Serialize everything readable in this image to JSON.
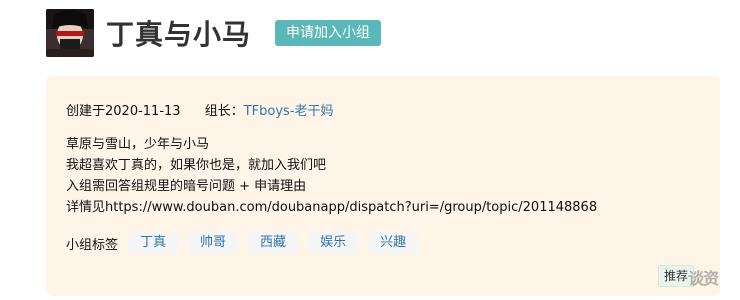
{
  "group": {
    "name": "丁真与小马",
    "join_button": "申请加入小组",
    "created_label": "创建于",
    "created_date": "2020-11-13",
    "owner_label": "组长：",
    "owner_name": "TFboys-老干妈",
    "description": [
      "草原与雪山，少年与小马",
      "我超喜欢丁真的，如果你也是，就加入我们吧",
      "入组需回答组规里的暗号问题 + 申请理由",
      "详情见https://www.douban.com/doubanapp/dispatch?uri=/group/topic/201148868"
    ],
    "tags_label": "小组标签",
    "tags": [
      "丁真",
      "帅哥",
      "西藏",
      "娱乐",
      "兴趣"
    ]
  },
  "recommend_button": "推荐",
  "watermark": "谈资",
  "colors": {
    "join_button_bg": "#5bb8b8",
    "card_bg": "#fef4e8",
    "link": "#3377aa"
  },
  "icons": {
    "avatar": "group-avatar-image"
  }
}
